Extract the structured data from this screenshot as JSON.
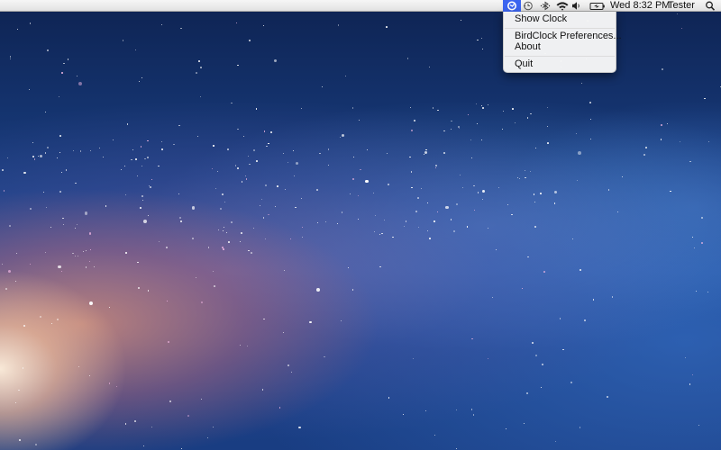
{
  "menubar": {
    "clock": "Wed 8:32 PM",
    "user": "Tester",
    "icons": {
      "app_status": "birdclock-icon",
      "time_machine": "time-machine-icon",
      "bluetooth": "bluetooth-icon",
      "wifi": "wifi-icon",
      "volume": "volume-icon",
      "battery": "battery-icon",
      "spotlight": "spotlight-search-icon"
    },
    "colors": {
      "highlight": "#3b64f0"
    }
  },
  "app_menu": {
    "items": [
      {
        "label": "Show Clock"
      },
      {
        "label": "BirdClock Preferences..."
      },
      {
        "label": "About"
      },
      {
        "label": "Quit"
      }
    ]
  }
}
